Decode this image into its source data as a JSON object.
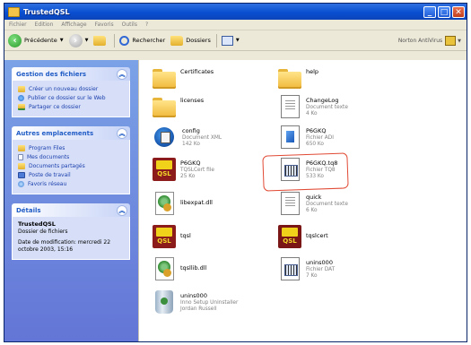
{
  "window": {
    "title": "TrustedQSL",
    "controls": [
      "_",
      "□",
      "✕"
    ]
  },
  "menu": [
    "Fichier",
    "Edition",
    "Affichage",
    "Favoris",
    "Outils",
    "?"
  ],
  "toolbar": {
    "back": "Précédente",
    "search": "Rechercher",
    "folders": "Dossiers",
    "norton": "Norton AntiVirus"
  },
  "panels": {
    "file_tasks": {
      "title": "Gestion des fichiers",
      "items": [
        "Créer un nouveau dossier",
        "Publier ce dossier sur le Web",
        "Partager ce dossier"
      ]
    },
    "other_places": {
      "title": "Autres emplacements",
      "items": [
        "Program Files",
        "Mes documents",
        "Documents partagés",
        "Poste de travail",
        "Favoris réseau"
      ]
    },
    "details": {
      "title": "Détails",
      "name": "TrustedQSL",
      "type": "Dossier de fichiers",
      "modified": "Date de modification: mercredi 22 octobre 2003, 15:16"
    }
  },
  "files": [
    {
      "name": "Certificates",
      "line1": "",
      "line2": "",
      "icon": "folder-icon"
    },
    {
      "name": "help",
      "line1": "",
      "line2": "",
      "icon": "folder-icon"
    },
    {
      "name": "licenses",
      "line1": "",
      "line2": "",
      "icon": "folder-icon"
    },
    {
      "name": "ChangeLog",
      "line1": "Document texte",
      "line2": "4 Ko",
      "icon": "text-document-icon"
    },
    {
      "name": "config",
      "line1": "Document XML",
      "line2": "142 Ko",
      "icon": "xml-document-icon"
    },
    {
      "name": "P6GKQ",
      "line1": "Fichier ADI",
      "line2": "650 Ko",
      "icon": "adi-file-icon"
    },
    {
      "name": "P6GKQ",
      "line1": "TQSLCert file",
      "line2": "25 Ko",
      "icon": "tqsl-cert-icon"
    },
    {
      "name": "P6GKQ.tq8",
      "line1": "Fichier TQ8",
      "line2": "533 Ko",
      "icon": "tq8-file-icon"
    },
    {
      "name": "libexpat.dll",
      "line1": "",
      "line2": "",
      "icon": "dll-icon"
    },
    {
      "name": "quick",
      "line1": "Document texte",
      "line2": "6 Ko",
      "icon": "text-document-icon"
    },
    {
      "name": "tqsl",
      "line1": "",
      "line2": "",
      "icon": "tqsl-app-icon"
    },
    {
      "name": "tqslcert",
      "line1": "",
      "line2": "",
      "icon": "tqslcert-app-icon"
    },
    {
      "name": "tqsllib.dll",
      "line1": "",
      "line2": "",
      "icon": "dll-icon"
    },
    {
      "name": "unins000",
      "line1": "Fichier DAT",
      "line2": "7 Ko",
      "icon": "dat-file-icon"
    },
    {
      "name": "unins000",
      "line1": "Inno Setup Uninstaller",
      "line2": "Jordan Russell",
      "icon": "uninstaller-icon"
    }
  ]
}
